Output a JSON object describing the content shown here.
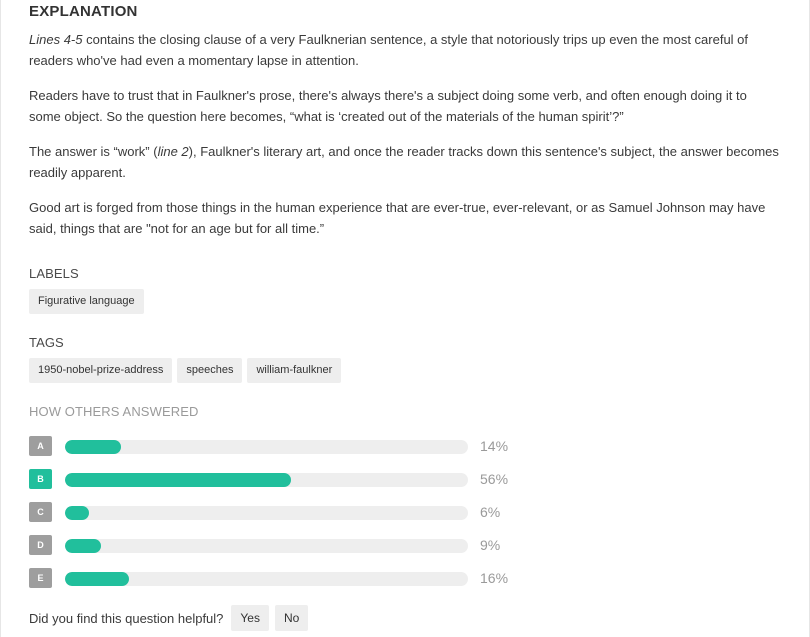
{
  "explanation": {
    "heading": "EXPLANATION",
    "p1_italic": "Lines 4-5",
    "p1_rest": " contains the closing clause of a very Faulknerian sentence, a style that notoriously trips up even the most careful of readers who've had even a momentary lapse in attention.",
    "p2": "Readers have to trust that in Faulkner's prose, there's always there's a subject doing some verb, and often enough doing it to some object. So the question here becomes, “what is ‘created out of the materials of the human spirit’?”",
    "p3_before": "The answer is “work” (",
    "p3_italic": "line 2",
    "p3_after": "), Faulkner's literary art, and once the reader tracks down this sentence's subject, the answer becomes readily apparent.",
    "p4": "Good art is forged from those things in the human experience that are ever-true, ever-relevant, or as Samuel Johnson may have said, things that are \"not for an age but for all time.”"
  },
  "labels": {
    "heading": "LABELS",
    "items": [
      "Figurative language"
    ]
  },
  "tags": {
    "heading": "TAGS",
    "items": [
      "1950-nobel-prize-address",
      "speeches",
      "william-faulkner"
    ]
  },
  "others": {
    "heading": "HOW OTHERS ANSWERED",
    "answers": [
      {
        "letter": "A",
        "percent": 14,
        "label": "14%",
        "correct": false
      },
      {
        "letter": "B",
        "percent": 56,
        "label": "56%",
        "correct": true
      },
      {
        "letter": "C",
        "percent": 6,
        "label": "6%",
        "correct": false
      },
      {
        "letter": "D",
        "percent": 9,
        "label": "9%",
        "correct": false
      },
      {
        "letter": "E",
        "percent": 16,
        "label": "16%",
        "correct": false
      }
    ]
  },
  "helpful": {
    "question": "Did you find this question helpful?",
    "yes": "Yes",
    "no": "No"
  },
  "colors": {
    "accent": "#21bf9c",
    "neutral_letter": "#9e9e9e",
    "track": "#eeeeee"
  }
}
